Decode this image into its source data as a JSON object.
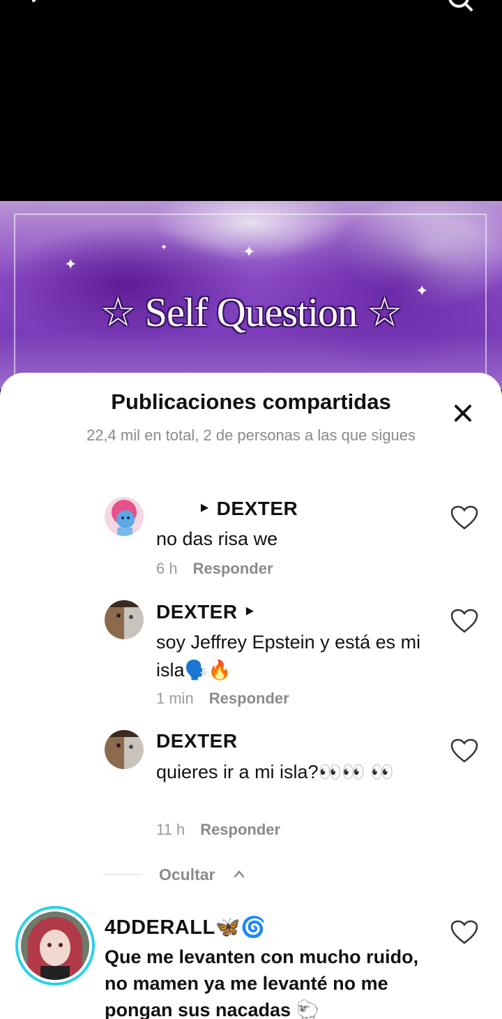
{
  "banner": {
    "title": "☆ Self Question ☆"
  },
  "sheet": {
    "title": "Publicaciones compartidas",
    "subtitle": "22,4 mil en total, 2 de personas a las que sigues"
  },
  "replies": [
    {
      "name": "‣ DEXTER",
      "text": "no das risa we",
      "time": "6 h",
      "reply_label": "Responder"
    },
    {
      "name": "DEXTER ‣",
      "text": "soy Jeffrey Epstein y está es mi isla🗣️🔥",
      "time": "1 min",
      "reply_label": "Responder"
    },
    {
      "name": "DEXTER",
      "text": "quieres ir a mi isla?👀👀 👀",
      "time": "11 h",
      "reply_label": "Responder"
    }
  ],
  "hide": {
    "label": "Ocultar"
  },
  "comment": {
    "name": "4DDERALL🦋🌀",
    "text": "Que me levanten con mucho ruido, no mamen ya me levanté no me pongan sus nacadas 🐑"
  },
  "colors": {
    "story_ring": "#2ad1e6",
    "banner_purple": "#7a3cb8"
  }
}
